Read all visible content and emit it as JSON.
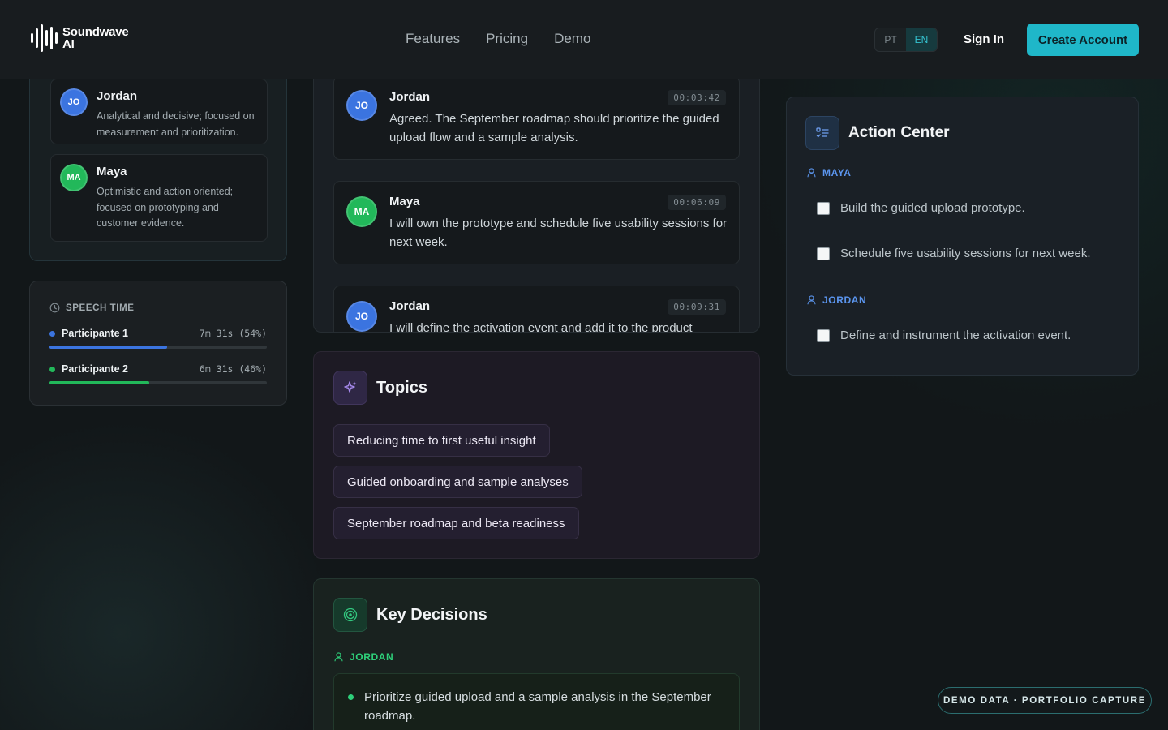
{
  "header": {
    "logo_line1": "Soundwave",
    "logo_line2": "AI",
    "nav": [
      "Features",
      "Pricing",
      "Demo"
    ],
    "lang_pt": "PT",
    "lang_en": "EN",
    "active_lang": "EN",
    "signin": "Sign In",
    "create_account": "Create Account"
  },
  "participants": [
    {
      "initials": "JO",
      "name": "Jordan",
      "description": "Analytical and decisive; focused on measurement and prioritization.",
      "color": "#3b74e0"
    },
    {
      "initials": "MA",
      "name": "Maya",
      "description": "Optimistic and action oriented; focused on prototyping and customer evidence.",
      "color": "#22b85a"
    }
  ],
  "speech_time": {
    "title": "SPEECH TIME",
    "rows": [
      {
        "label": "Participante 1",
        "value": "7m 31s (54%)",
        "share": 0.54,
        "color": "#3b74e0"
      },
      {
        "label": "Participante 2",
        "value": "6m 31s (46%)",
        "share": 0.46,
        "color": "#22b85a"
      }
    ]
  },
  "transcript": [
    {
      "initials": "JO",
      "name": "Jordan",
      "time": "00:03:42",
      "text": "Agreed. The September roadmap should prioritize the guided upload flow and a sample analysis."
    },
    {
      "initials": "MA",
      "name": "Maya",
      "time": "00:06:09",
      "text": "I will own the prototype and schedule five usability sessions for next week."
    },
    {
      "initials": "JO",
      "name": "Jordan",
      "time": "00:09:31",
      "text": "I will define the activation event and add it to the product"
    }
  ],
  "topics": {
    "title": "Topics",
    "items": [
      "Reducing time to first useful insight",
      "Guided onboarding and sample analyses",
      "September roadmap and beta readiness"
    ]
  },
  "decisions": {
    "title": "Key Decisions",
    "owner": "JORDAN",
    "items": [
      "Prioritize guided upload and a sample analysis in the September roadmap."
    ]
  },
  "action_center": {
    "title": "Action Center",
    "groups": [
      {
        "owner": "MAYA",
        "tasks": [
          "Build the guided upload prototype.",
          "Schedule five usability sessions for next week."
        ]
      },
      {
        "owner": "JORDAN",
        "tasks": [
          "Define and instrument the activation event."
        ]
      }
    ]
  },
  "badge": "DEMO DATA · PORTFOLIO CAPTURE"
}
